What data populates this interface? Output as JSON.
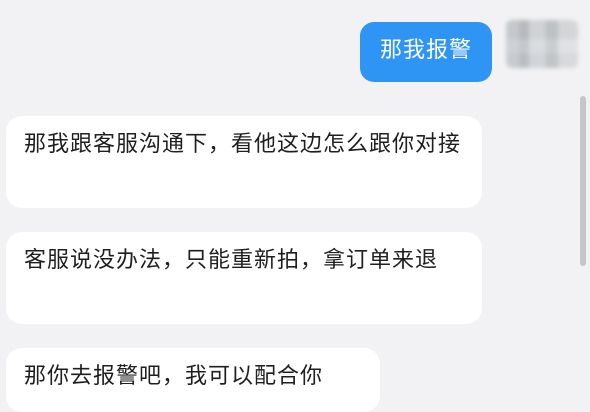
{
  "messages": [
    {
      "id": "m1",
      "direction": "outgoing",
      "text": "那我报警"
    },
    {
      "id": "m2",
      "direction": "incoming",
      "text": "那我跟客服沟通下，看他这边怎么跟你对接"
    },
    {
      "id": "m3",
      "direction": "incoming",
      "text": "客服说没办法，只能重新拍，拿订单来退"
    },
    {
      "id": "m4",
      "direction": "incoming",
      "text": "那你去报警吧，我可以配合你"
    }
  ],
  "colors": {
    "background": "#f2f2f4",
    "outgoing_bubble": "#2f95f5",
    "incoming_bubble": "#ffffff",
    "text": "#1f1f1f"
  }
}
